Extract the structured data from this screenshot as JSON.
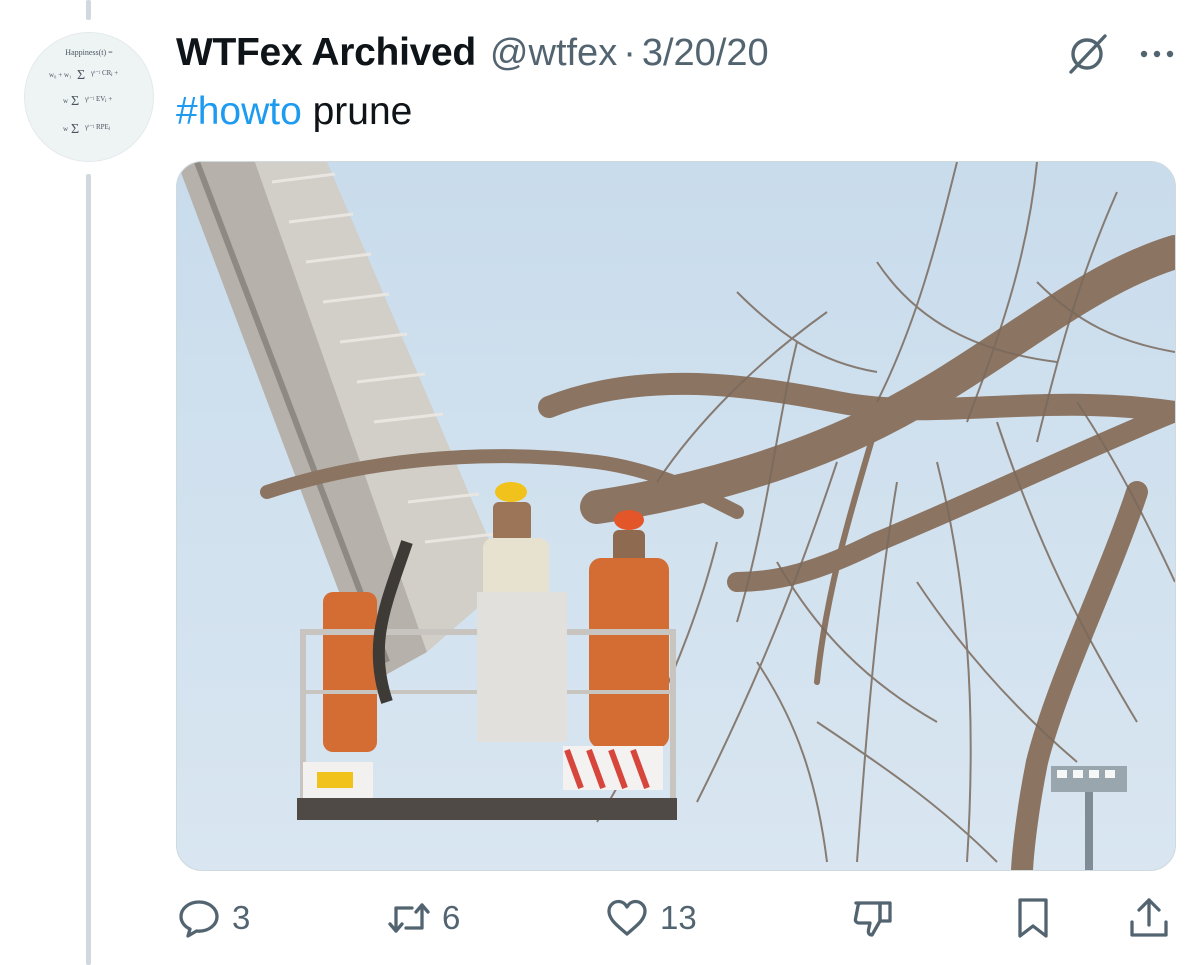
{
  "tweet": {
    "display_name": "WTFex Archived",
    "handle": "@wtfex",
    "separator": "·",
    "date": "3/20/20",
    "text": {
      "hashtag": "#howto",
      "body": " prune"
    },
    "avatar": {
      "title": "Happiness(t) ="
    },
    "media": {
      "icon": "photo"
    }
  },
  "actions": {
    "reply": {
      "icon": "speech-bubble",
      "count": "3"
    },
    "repost": {
      "icon": "repost-arrows",
      "count": "6"
    },
    "like": {
      "icon": "heart",
      "count": "13"
    },
    "downvote": {
      "icon": "thumbs-down"
    },
    "bookmark": {
      "icon": "bookmark"
    },
    "share": {
      "icon": "share-up-arrow"
    }
  },
  "colors": {
    "text": "#0f1419",
    "secondary": "#536471",
    "link": "#1d9bf0",
    "border": "#cfd9de"
  }
}
